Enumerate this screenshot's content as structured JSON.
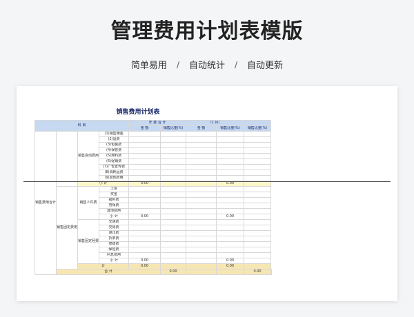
{
  "header": {
    "title": "管理费用计划表模版",
    "features": [
      "简单易用",
      "自动统计",
      "自动更新"
    ],
    "separator": "/"
  },
  "sheet": {
    "title": "销售费用计划表",
    "headers": {
      "subject": "科    目",
      "annual_total": "年 度 合 计",
      "month": "（1  月）",
      "amount": "金  额",
      "ratio": "销售比重(%)",
      "ratio2": "销售比重(%)"
    },
    "groups": {
      "sales_cost_total": "销售费用合计",
      "variable": "销售变动费用",
      "fixed": "销售固定费用",
      "personnel": "销售人件费",
      "fixed_expense": "销售固定经费"
    },
    "variable_items": [
      "(1)销售佣金",
      "(2)运费",
      "(3)包装费",
      "(4)保管费",
      "(5)燃料费",
      "(6)促销费",
      "(7)广告宣传费",
      "(8)消耗品费",
      "(9)其他费用"
    ],
    "personnel_items": [
      "工资",
      "奖金",
      "福利费",
      "劳保费",
      "其他费用"
    ],
    "fixed_items": [
      "交通费",
      "交际费",
      "通讯费",
      "折旧费",
      "修缮费",
      "保险费",
      "利息费用"
    ],
    "subtotal_label": "小    计",
    "total_label": "计",
    "grand_total_label": "合    计",
    "zero": "0.00"
  }
}
